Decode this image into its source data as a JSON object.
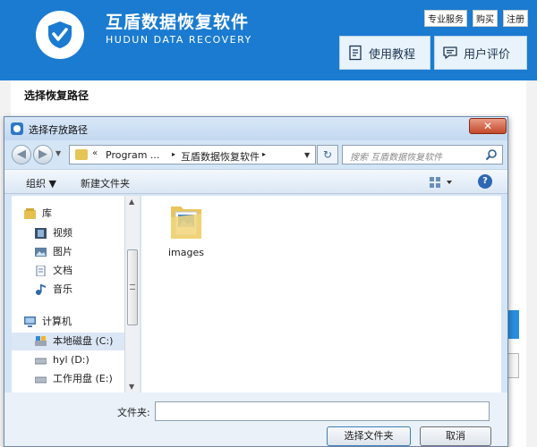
{
  "app": {
    "title": "互盾数据恢复软件",
    "subtitle": "HUDUN DATA RECOVERY",
    "top_links": [
      "专业服务",
      "购买",
      "注册"
    ],
    "header_buttons": {
      "tutorial": "使用教程",
      "reviews": "用户评价"
    },
    "panel_title": "选择恢复路径"
  },
  "dialog": {
    "title": "选择存放路径",
    "close_glyph": "✕",
    "address": {
      "chevron": "«",
      "parts": [
        "Program ...",
        "互盾数据恢复软件"
      ],
      "separator": "▸"
    },
    "search_placeholder": "搜索 互盾数据恢复软件",
    "toolbar": {
      "organize": "组织 ▼",
      "new_folder": "新建文件夹"
    },
    "nav": [
      {
        "label": "库",
        "icon": "library-icon",
        "indent": 1
      },
      {
        "label": "视频",
        "icon": "video-icon",
        "indent": 2
      },
      {
        "label": "图片",
        "icon": "picture-icon",
        "indent": 2
      },
      {
        "label": "文档",
        "icon": "document-icon",
        "indent": 2
      },
      {
        "label": "音乐",
        "icon": "music-icon",
        "indent": 2
      },
      {
        "label": "计算机",
        "icon": "computer-icon",
        "indent": 1
      },
      {
        "label": "本地磁盘 (C:)",
        "icon": "drive-icon",
        "indent": 2,
        "selected": true
      },
      {
        "label": "hyl (D:)",
        "icon": "drive-icon",
        "indent": 2
      },
      {
        "label": "工作用盘 (E:)",
        "icon": "drive-icon",
        "indent": 2
      }
    ],
    "files": [
      {
        "label": "images",
        "icon": "folder-icon"
      }
    ],
    "folder_label": "文件夹:",
    "folder_value": "",
    "buttons": {
      "select": "选择文件夹",
      "cancel": "取消"
    }
  },
  "colors": {
    "header_blue": "#1a7bd0",
    "dialog_frame": "#d4e5f6",
    "close_red": "#c24a2c"
  }
}
